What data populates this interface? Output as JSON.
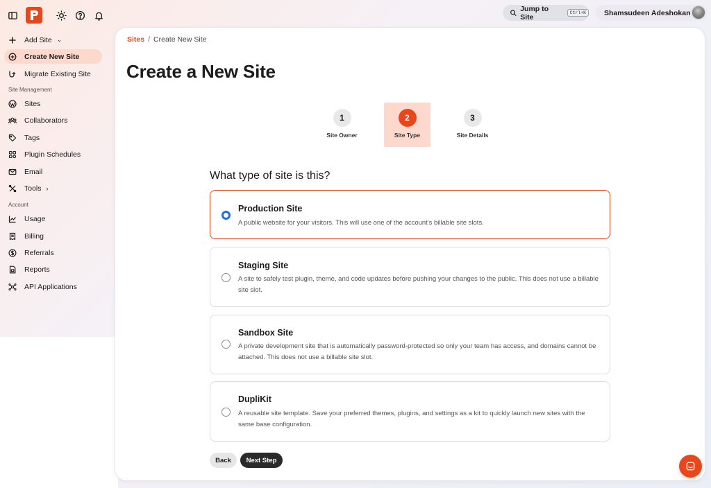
{
  "topbar": {
    "jump_label": "Jump to Site",
    "jump_shortcut": "Ctrl+K",
    "user_name": "Shamsudeen Adeshokan"
  },
  "sidebar": {
    "items_top": [
      {
        "label": "Add Site",
        "icon": "plus-icon"
      },
      {
        "label": "Create New Site",
        "icon": "plus-circle-icon",
        "active": true
      },
      {
        "label": "Migrate Existing Site",
        "icon": "migrate-icon"
      }
    ],
    "section_site_management": "Site Management",
    "items_site": [
      {
        "label": "Sites",
        "icon": "wordpress-icon"
      },
      {
        "label": "Collaborators",
        "icon": "users-icon"
      },
      {
        "label": "Tags",
        "icon": "tag-icon"
      },
      {
        "label": "Plugin Schedules",
        "icon": "plugin-icon"
      },
      {
        "label": "Email",
        "icon": "mail-icon"
      },
      {
        "label": "Tools",
        "icon": "tools-icon"
      }
    ],
    "section_account": "Account",
    "items_account": [
      {
        "label": "Usage",
        "icon": "chart-icon"
      },
      {
        "label": "Billing",
        "icon": "billing-icon"
      },
      {
        "label": "Referrals",
        "icon": "dollar-icon"
      },
      {
        "label": "Reports",
        "icon": "report-icon"
      },
      {
        "label": "API Applications",
        "icon": "api-icon"
      }
    ]
  },
  "main": {
    "breadcrumb": {
      "root": "Sites",
      "separator": "/",
      "current": "Create New Site"
    },
    "title": "Create a New Site",
    "steps": [
      {
        "number": "1",
        "label": "Site Owner"
      },
      {
        "number": "2",
        "label": "Site Type",
        "active": true
      },
      {
        "number": "3",
        "label": "Site Details"
      }
    ],
    "question": "What type of site is this?",
    "options": [
      {
        "title": "Production Site",
        "description": "A public website for your visitors. This will use one of the account's billable site slots.",
        "selected": true
      },
      {
        "title": "Staging Site",
        "description": "A site to safely test plugin, theme, and code updates before pushing your changes to the public. This does not use a billable site slot."
      },
      {
        "title": "Sandbox Site",
        "description": "A private development site that is automatically password-protected so only your team has access, and domains cannot be attached. This does not use a billable site slot."
      },
      {
        "title": "DupliKit",
        "description": "A reusable site template. Save your preferred themes, plugins, and settings as a kit to quickly launch new sites with the same base configuration."
      }
    ],
    "back_label": "Back",
    "next_label": "Next Step"
  },
  "colors": {
    "accent": "#e8471e",
    "accent_soft": "#fcd9cc",
    "radio": "#1f6fdc"
  }
}
